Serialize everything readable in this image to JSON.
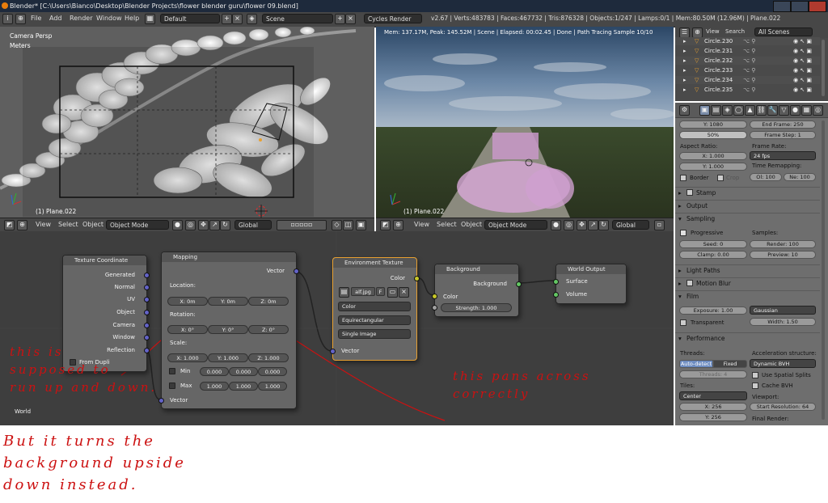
{
  "title_bar": {
    "text": "Blender* [C:\\Users\\Bianco\\Desktop\\Blender Projects\\flower blender guru\\flower 09.blend]"
  },
  "info_header": {
    "menus": [
      "File",
      "Add",
      "Render",
      "Window",
      "Help"
    ],
    "layout": "Default",
    "scene": "Scene",
    "engine": "Cycles Render",
    "stats": "v2.67 | Verts:483783 | Faces:467732 | Tris:876328 | Objects:1/247 | Lamps:0/1 | Mem:80.50M (12.96M) | Plane.022"
  },
  "viewport_left": {
    "view_name": "Camera Persp",
    "units": "Meters",
    "object": "(1) Plane.022"
  },
  "viewport_right": {
    "render_info": "Mem: 137.17M, Peak: 145.52M | Scene | Elapsed: 00:02.45 | Done | Path Tracing Sample 10/10",
    "object": "(1) Plane.022"
  },
  "view3d_header": {
    "menus": [
      "View",
      "Select",
      "Object"
    ],
    "mode": "Object Mode",
    "orientation": "Global"
  },
  "node_editor": {
    "world_label": "World",
    "tex_coord": {
      "title": "Texture Coordinate",
      "outputs": [
        "Generated",
        "Normal",
        "UV",
        "Object",
        "Camera",
        "Window",
        "Reflection"
      ],
      "from_dupli": "From Dupli"
    },
    "mapping": {
      "title": "Mapping",
      "output": "Vector",
      "location_label": "Location:",
      "location": [
        "X: 0m",
        "Y: 0m",
        "Z: 0m"
      ],
      "rotation_label": "Rotation:",
      "rotation": [
        "X: 0°",
        "Y: 0°",
        "Z: 0°"
      ],
      "scale_label": "Scale:",
      "scale": [
        "X: 1.000",
        "Y: 1.000",
        "Z: 1.000"
      ],
      "min_label": "Min",
      "min": [
        "0.000",
        "0.000",
        "0.000"
      ],
      "max_label": "Max",
      "max": [
        "1.000",
        "1.000",
        "1.000"
      ],
      "input": "Vector"
    },
    "env_texture": {
      "title": "Environment Texture",
      "output": "Color",
      "image": "alf.jpg",
      "f_label": "F",
      "color_mode": "Color",
      "projection": "Equirectangular",
      "source": "Single Image",
      "input": "Vector"
    },
    "background": {
      "title": "Background",
      "output": "Background",
      "color_label": "Color",
      "strength": "Strength: 1.000"
    },
    "world_output": {
      "title": "World Output",
      "inputs": [
        "Surface",
        "Volume"
      ]
    }
  },
  "outliner": {
    "view": "View",
    "search": "Search",
    "scope": "All Scenes",
    "items": [
      "Circle.230",
      "Circle.231",
      "Circle.232",
      "Circle.233",
      "Circle.234",
      "Circle.235"
    ]
  },
  "properties": {
    "y_res": "Y: 1080",
    "end_frame": "End Frame: 250",
    "percent": "50%",
    "frame_step": "Frame Step: 1",
    "aspect_label": "Aspect Ratio:",
    "frame_rate_label": "Frame Rate:",
    "aspect_x": "X: 1.000",
    "fps": "24 fps",
    "time_remap_label": "Time Remapping:",
    "aspect_y": "Y: 1.000",
    "border": "Border",
    "crop": "Crop",
    "old": "Ol: 100",
    "new": "Ne: 100",
    "stamp": "Stamp",
    "output": "Output",
    "sampling": "Sampling",
    "progressive": "Progressive",
    "samples_label": "Samples:",
    "seed": "Seed: 0",
    "render_samples": "Render: 100",
    "clamp": "Clamp: 0.00",
    "preview_samples": "Preview: 10",
    "light_paths": "Light Paths",
    "motion_blur": "Motion Blur",
    "film": "Film",
    "exposure": "Exposure: 1.00",
    "filter": "Gaussian",
    "transparent": "Transparent",
    "width": "Width: 1.50",
    "performance": "Performance",
    "threads_label": "Threads:",
    "accel_label": "Acceleration structure:",
    "auto_detect": "Auto-detect",
    "fixed": "Fixed",
    "bvh": "Dynamic BVH",
    "threads": "Threads: 4",
    "spatial_splits": "Use Spatial Splits",
    "tiles_label": "Tiles:",
    "cache_bvh": "Cache BVH",
    "tile_order": "Center",
    "viewport_label": "Viewport:",
    "tile_x": "X: 256",
    "start_res": "Start Resolution: 64",
    "tile_y": "Y: 256",
    "final_render": "Final Render:"
  },
  "annotations": {
    "left": [
      "this is",
      "supposed to",
      "run up and down."
    ],
    "right": [
      "this pans across",
      "correctly"
    ],
    "bottom": [
      "But it turns the",
      "background upside",
      "down instead."
    ]
  },
  "colors": {
    "annotation": "#cc1111",
    "socket_vector": "#6363c7",
    "socket_color": "#c7c729",
    "socket_shader": "#63c763",
    "node_bg": "#666666",
    "editor_bg": "#3e3e3e"
  }
}
